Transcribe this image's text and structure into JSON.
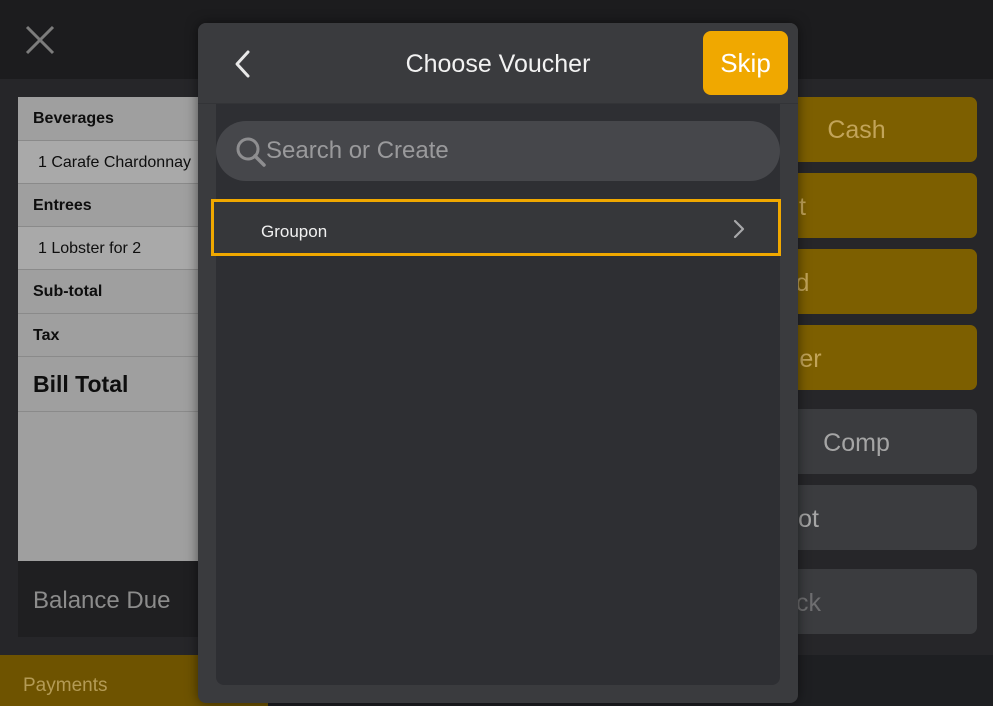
{
  "bill": {
    "rows": [
      {
        "label": "Beverages"
      },
      {
        "label": "1 Carafe Chardonnay"
      },
      {
        "label": "Entrees"
      },
      {
        "label": "1 Lobster for 2"
      },
      {
        "label": "Sub-total"
      },
      {
        "label": "Tax"
      },
      {
        "label": "Bill Total"
      }
    ],
    "balance_label": "Balance Due"
  },
  "payments_label": "Payments",
  "payment_buttons": [
    {
      "label": "Cash"
    },
    {
      "label": "t"
    },
    {
      "label": "d"
    },
    {
      "label": "er"
    },
    {
      "label": "Comp"
    },
    {
      "label": "ot"
    },
    {
      "label": "ck"
    }
  ],
  "modal": {
    "title": "Choose Voucher",
    "skip_label": "Skip",
    "search_placeholder": "Search or Create",
    "vouchers": [
      {
        "label": "Groupon",
        "selected": true
      }
    ]
  },
  "colors": {
    "accent": "#f0a800",
    "modal_bg": "#3a3b3e",
    "list_bg": "#2e2f33"
  }
}
